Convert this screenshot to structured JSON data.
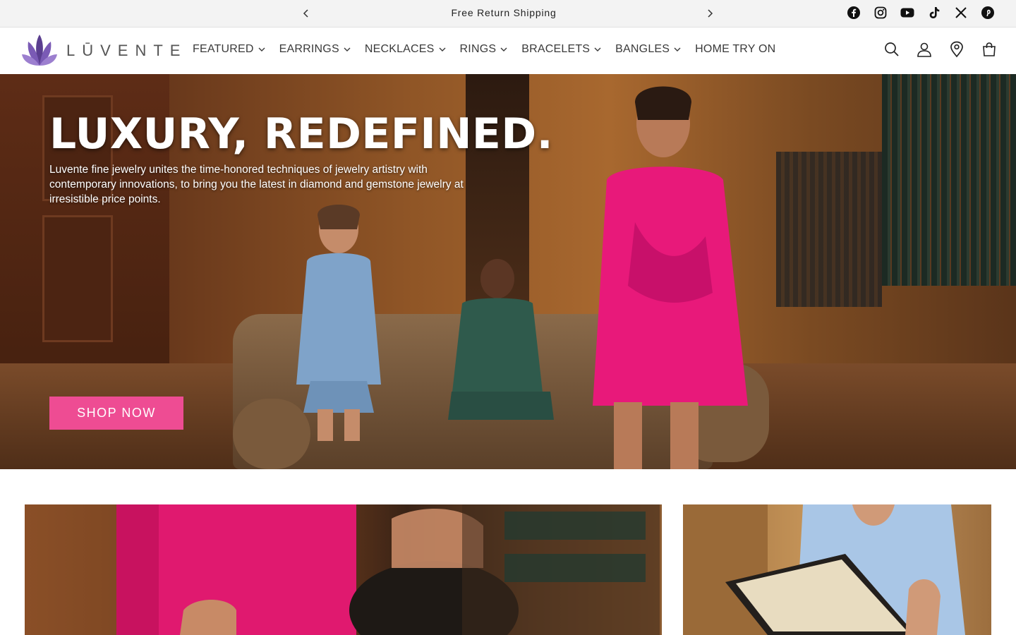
{
  "announcement": {
    "message": "Free Return Shipping",
    "prev_icon": "chevron-left-icon",
    "next_icon": "chevron-right-icon"
  },
  "social": [
    "facebook-icon",
    "instagram-icon",
    "youtube-icon",
    "tiktok-icon",
    "x-icon",
    "pinterest-icon"
  ],
  "header": {
    "logo_text": "LŪVENTE",
    "nav": [
      {
        "label": "FEATURED",
        "has_dropdown": true
      },
      {
        "label": "EARRINGS",
        "has_dropdown": true
      },
      {
        "label": "NECKLACES",
        "has_dropdown": true
      },
      {
        "label": "RINGS",
        "has_dropdown": true
      },
      {
        "label": "BRACELETS",
        "has_dropdown": true
      },
      {
        "label": "BANGLES",
        "has_dropdown": true
      },
      {
        "label": "HOME TRY ON",
        "has_dropdown": false
      }
    ],
    "icons": [
      "search-icon",
      "account-icon",
      "location-icon",
      "cart-icon"
    ]
  },
  "hero": {
    "title": "LUXURY, REDEFINED.",
    "description": "Luvente fine jewelry unites the time-honored techniques of jewelry artistry with contemporary innovations, to bring you the latest in diamond and gemstone jewelry at irresistible price points.",
    "cta": "SHOP NOW"
  },
  "colors": {
    "accent": "#ee4c93",
    "logo_purple": "#6b4fa0",
    "announcement_bg": "#f3f3f3"
  }
}
